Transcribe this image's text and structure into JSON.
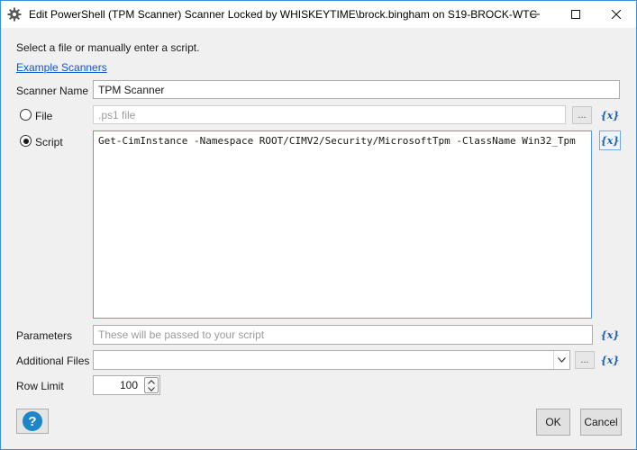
{
  "window": {
    "title": "Edit PowerShell (TPM Scanner) Scanner Locked by WHISKEYTIME\\brock.bingham on S19-BROCK-WTC",
    "icon": "gear-icon",
    "controls": [
      "minimize-icon",
      "maximize-icon",
      "close-icon"
    ]
  },
  "intro": {
    "instruction": "Select a file or manually enter a script.",
    "example_link": "Example Scanners"
  },
  "scanner_name": {
    "label": "Scanner Name",
    "value": "TPM Scanner"
  },
  "file": {
    "label": "File",
    "selected": false,
    "placeholder": ".ps1 file",
    "browse_label": "...",
    "variable_label": "{x}"
  },
  "script": {
    "label": "Script",
    "selected": true,
    "value": "Get-CimInstance -Namespace ROOT/CIMV2/Security/MicrosoftTpm -ClassName Win32_Tpm",
    "variable_label": "{x}"
  },
  "parameters": {
    "label": "Parameters",
    "placeholder": "These will be passed to your script",
    "variable_label": "{x}"
  },
  "additional_files": {
    "label": "Additional Files",
    "value": "",
    "browse_label": "...",
    "variable_label": "{x}"
  },
  "row_limit": {
    "label": "Row Limit",
    "value": "100"
  },
  "footer": {
    "help_label": "?",
    "ok_label": "OK",
    "cancel_label": "Cancel"
  },
  "colors": {
    "window_border": "#3c8ed6",
    "link": "#0b57d0",
    "variable_icon": "#1f5fb4",
    "help_button": "#1c86c9"
  }
}
